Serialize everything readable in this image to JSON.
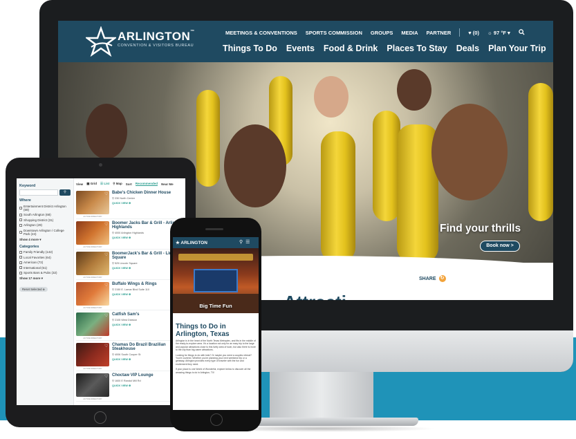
{
  "desktop": {
    "logo_text": "ARLINGTON",
    "logo_tm": "™",
    "logo_sub": "CONVENTION & VISITORS BUREAU",
    "top_nav": [
      "MEETINGS & CONVENTIONS",
      "SPORTS COMMISSION",
      "GROUPS",
      "MEDIA",
      "PARTNER"
    ],
    "favorites_label": "♥ (0)",
    "weather_label": "☼ 97 °F ▾",
    "main_nav": [
      "Things To Do",
      "Events",
      "Food & Drink",
      "Places To Stay",
      "Deals",
      "Plan Your Trip"
    ],
    "hero_title": "Find your thrills",
    "hero_button": "Book now >",
    "share_label": "SHARE",
    "heading_peek": "Attracti"
  },
  "tablet": {
    "keyword_label": "Keyword",
    "where_label": "Where",
    "where_items": [
      "Entertainment District Arlington (69)",
      "South Arlington (68)",
      "Shopping District (31)",
      "Arlington (29)",
      "Downtown Arlington / College Park (24)"
    ],
    "show_more": "Show 4 more ▾",
    "categories_label": "Categories",
    "category_items": [
      "Family Friendly (142)",
      "Local Favorites (64)",
      "American (72)",
      "International (51)",
      "Sports Bars & Pubs (32)"
    ],
    "show_more_2": "Show 17 more ▾",
    "reset_label": "Reset Selected ⊗",
    "view_label": "View",
    "view_modes": [
      "▦ Grid",
      "☰ List",
      "⚲ Map"
    ],
    "sort_label": "Sort",
    "sort_options": [
      "Recommended",
      "Near Me"
    ],
    "listings": [
      {
        "title": "Babe's Chicken Dinner House",
        "address": "230 North Center",
        "quick_view": "QUICK VIEW ⊕",
        "caption": "ACTIVE DIRECTORY"
      },
      {
        "title": "Boomer Jacks Bar & Grill - Arlington Highlands",
        "address": "4000 Arlington Highlands",
        "quick_view": "QUICK VIEW ⊕",
        "caption": "ACTIVE DIRECTORY"
      },
      {
        "title": "BoomerJack's Bar & Grill - Lincoln Square",
        "address": "525 Lincoln Square",
        "quick_view": "QUICK VIEW ⊕",
        "caption": "ACTIVE DIRECTORY"
      },
      {
        "title": "Buffalo Wings & Rings",
        "address": "2150 E. Lamar Blvd Suite 110",
        "quick_view": "QUICK VIEW ⊕",
        "caption": "ACTIVE DIRECTORY"
      },
      {
        "title": "Catfish Sam's",
        "address": "2105 West Division",
        "quick_view": "QUICK VIEW ⊕",
        "caption": "ACTIVE DIRECTORY"
      },
      {
        "title": "Chamas Do Brazil Brazilian Steakhouse",
        "address": "4006 South Cooper St",
        "quick_view": "QUICK VIEW ⊕",
        "caption": "ACTIVE DIRECTORY"
      },
      {
        "title": "Choctaw VIP Lounge",
        "address": "1600 E Randol Mill Rd",
        "quick_view": "QUICK VIEW ⊕",
        "caption": "ACTIVE DIRECTORY"
      }
    ]
  },
  "phone": {
    "logo_text": "ARLINGTON",
    "hero_caption": "Big Time Fun",
    "title": "Things to Do in Arlington, Texas",
    "paragraphs": [
      "Arlington is in the heart of the North Texas Metroplex, and fits in the middle of the ready-to-explore area. It's a location not only for an easy trip to the large and popular attractions close to this lively area of town, but also there is more to the city than big-name attractions.",
      "Looking for things to do with kids? Or maybe you need a couples retreat? You're covered. Whether you're planning your next weekend trip or a getaway, Arlington provides every type of traveler with the fun and excitement they need.",
      "If your place is one World of Wonderful, explore below to discover all the amazing things to do in Arlington, TX!"
    ]
  }
}
